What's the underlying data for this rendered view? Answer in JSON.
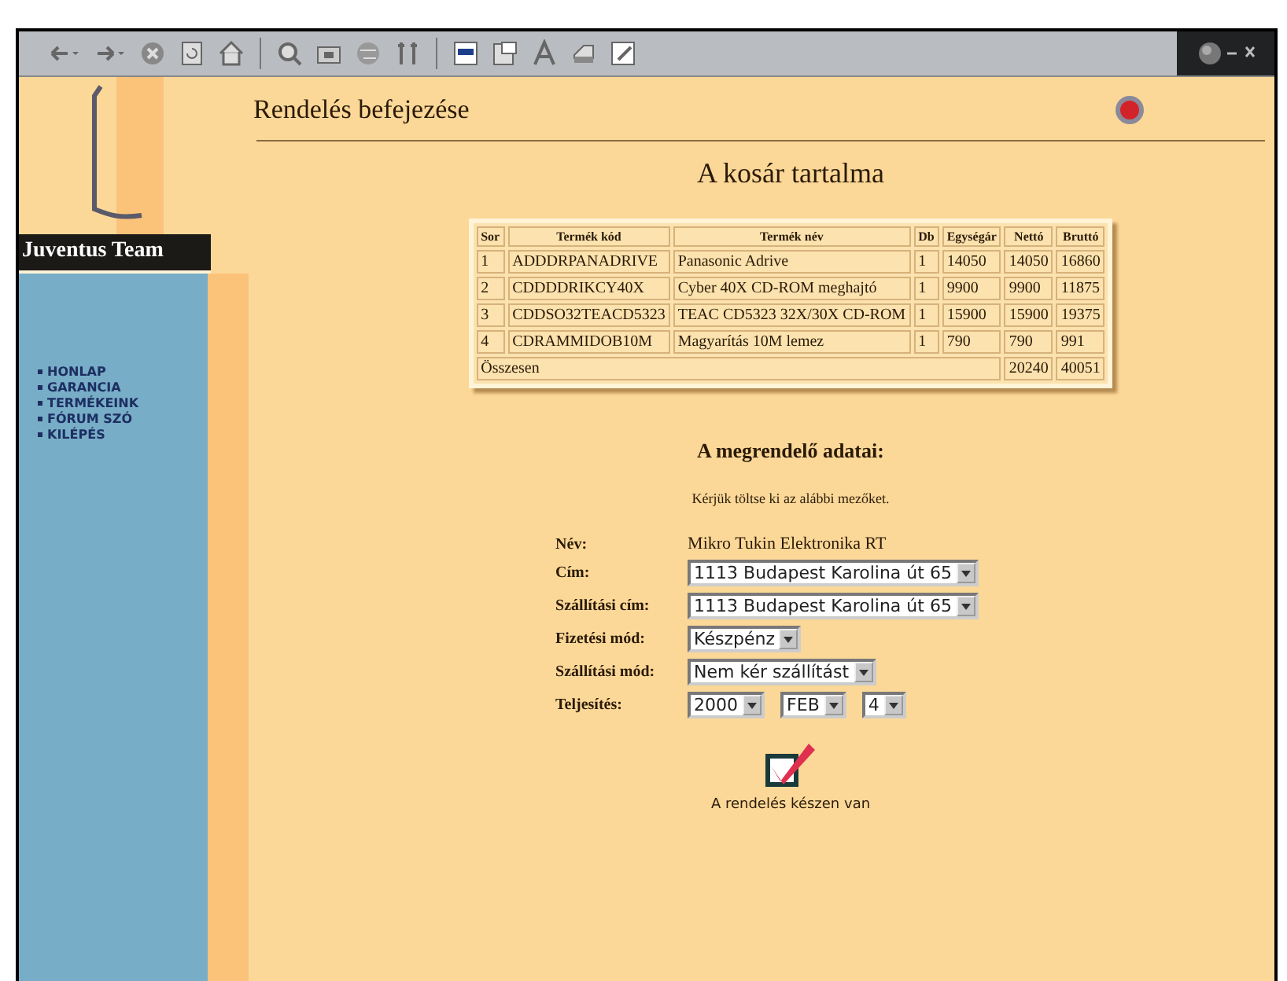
{
  "site": {
    "brand": "Juventus Team"
  },
  "nav": [
    {
      "label": "HONLAP"
    },
    {
      "label": "GARANCIA"
    },
    {
      "label": "TERMÉKEINK"
    },
    {
      "label": "FÓRUM SZÓ"
    },
    {
      "label": "KILÉPÉS"
    }
  ],
  "page": {
    "title": "Rendelés befejezése",
    "cart_heading": "A kosár tartalma"
  },
  "cart": {
    "columns": [
      "Sor",
      "Termék kód",
      "Termék név",
      "Db",
      "Egységár",
      "Nettó",
      "Bruttó"
    ],
    "rows": [
      [
        "1",
        "ADDDRPANADRIVE",
        "Panasonic Adrive",
        "1",
        "14050",
        "14050",
        "16860"
      ],
      [
        "2",
        "CDDDDRIKCY40X",
        "Cyber 40X CD-ROM meghajtó",
        "1",
        "9900",
        "9900",
        "11875"
      ],
      [
        "3",
        "CDDSO32TEACD5323",
        "TEAC CD5323 32X/30X CD-ROM",
        "1",
        "15900",
        "15900",
        "19375"
      ],
      [
        "4",
        "CDRAMMIDOB10M",
        "Magyarítás 10M lemez",
        "1",
        "790",
        "790",
        "991"
      ]
    ],
    "total": {
      "label": "Összesen",
      "net": "20240",
      "gross": "40051"
    }
  },
  "form": {
    "heading": "A megrendelő adatai:",
    "hint": "Kérjük töltse ki az alábbi mezőket.",
    "fields": [
      {
        "kind": "text",
        "label": "Név:",
        "value": "Mikro Tukin Elektronika RT"
      },
      {
        "kind": "select",
        "label": "Cím:",
        "values": [
          "1113 Budapest Karolina út 65"
        ]
      },
      {
        "kind": "select",
        "label": "Szállítási cím:",
        "values": [
          "1113 Budapest Karolina út 65"
        ]
      },
      {
        "kind": "select",
        "label": "Fizetési mód:",
        "values": [
          "Készpénz"
        ]
      },
      {
        "kind": "select",
        "label": "Szállítási mód:",
        "values": [
          "Nem kér szállítást"
        ]
      },
      {
        "kind": "select",
        "label": "Teljesítés:",
        "values": [
          "2000",
          "FEB",
          "4"
        ]
      }
    ],
    "submit_label": "A rendelés készen van"
  }
}
